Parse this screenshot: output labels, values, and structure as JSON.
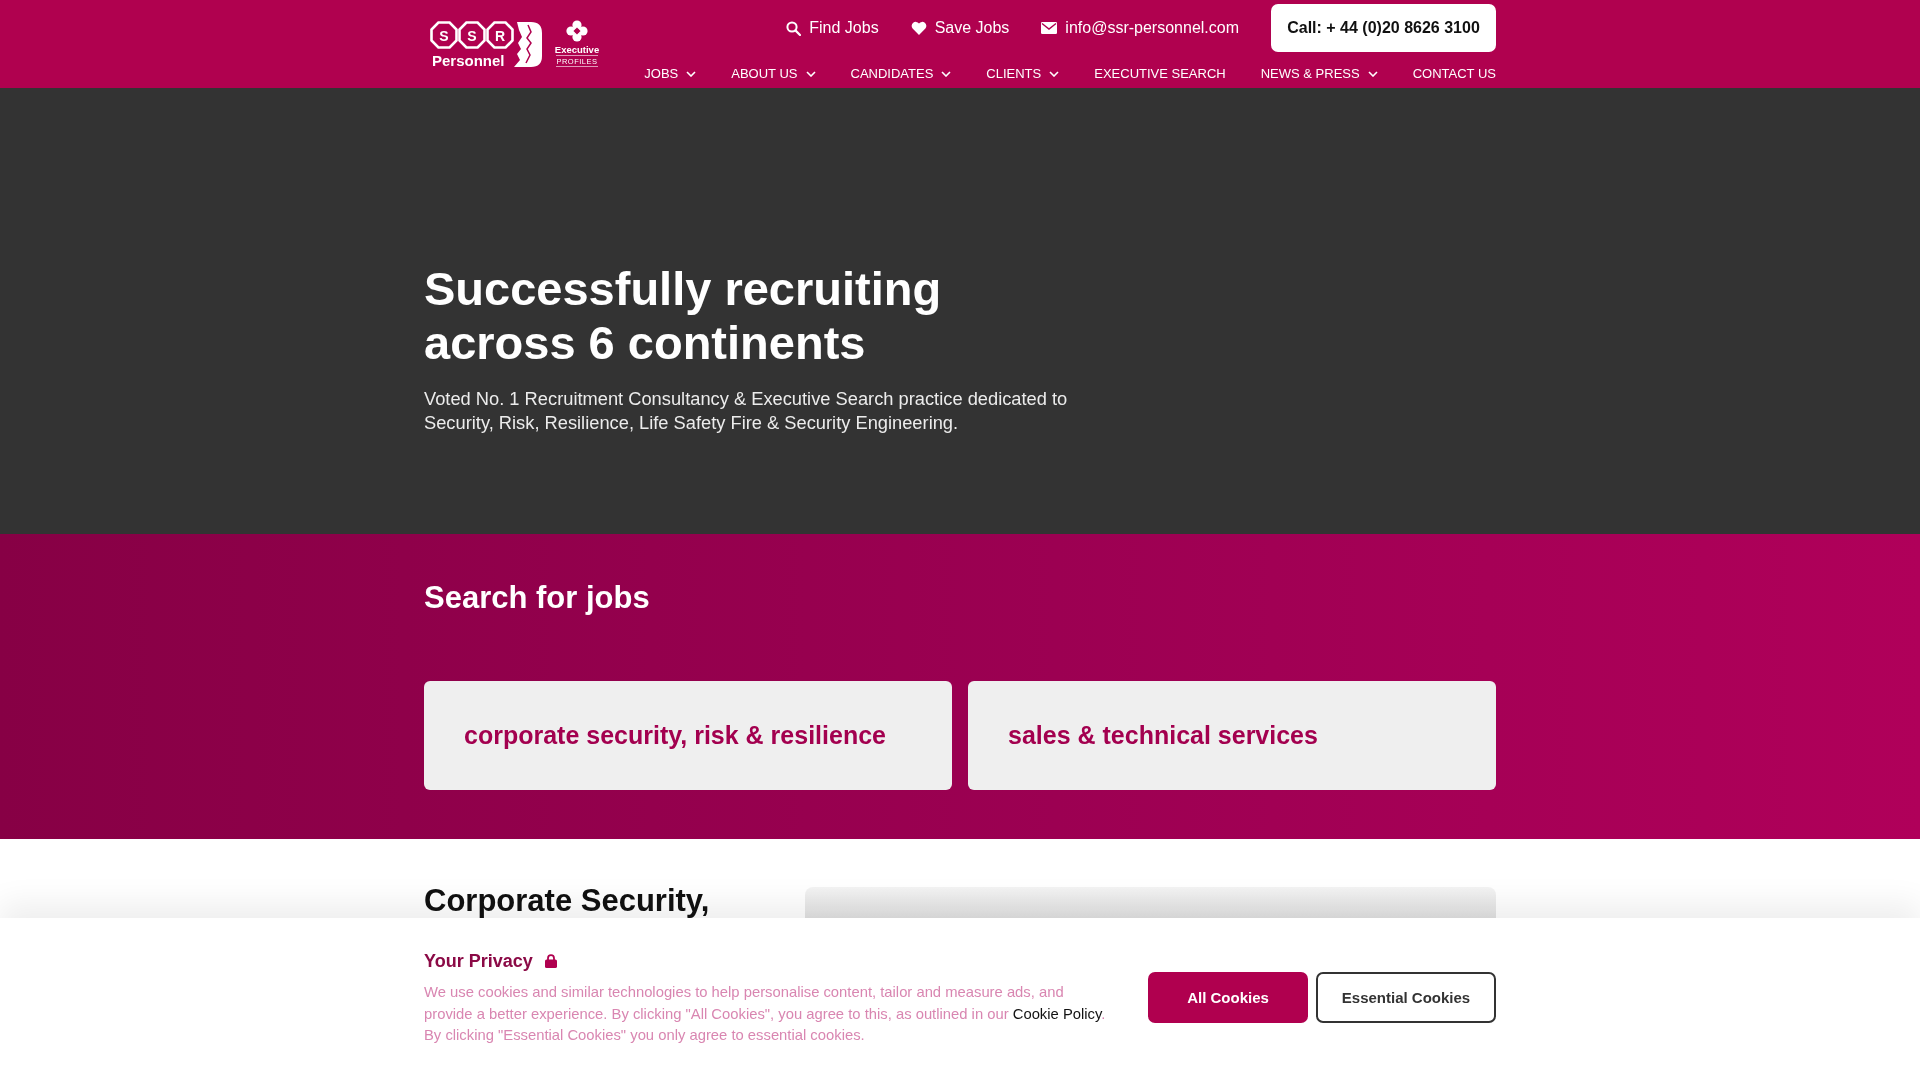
{
  "header": {
    "logo": {
      "letters": [
        "S",
        "S",
        "R"
      ],
      "name": "Personnel"
    },
    "partner_logo": {
      "name": "Executive",
      "tagline": "PROFILES"
    },
    "utility_links": [
      {
        "kind": "search",
        "label": "Find Jobs"
      },
      {
        "kind": "heart",
        "label": "Save Jobs"
      },
      {
        "kind": "email",
        "label": "info@ssr-personnel.com"
      }
    ],
    "call_button": "Call: + 44 (0)20 8626 3100",
    "nav": [
      {
        "label": "JOBS",
        "dropdown": true
      },
      {
        "label": "ABOUT US",
        "dropdown": true
      },
      {
        "label": "CANDIDATES",
        "dropdown": true
      },
      {
        "label": "CLIENTS",
        "dropdown": true
      },
      {
        "label": "EXECUTIVE SEARCH",
        "dropdown": false
      },
      {
        "label": "NEWS & PRESS",
        "dropdown": true
      },
      {
        "label": "CONTACT US",
        "dropdown": false
      }
    ]
  },
  "hero": {
    "title": "Successfully recruiting across 6 continents",
    "subtitle": "Voted No. 1 Recruitment Consultancy & Executive Search practice dedicated to Security, Risk, Resilience, Life Safety Fire & Security Engineering."
  },
  "job_search": {
    "title": "Search for jobs",
    "categories": [
      "corporate security, risk & resilience",
      "sales & technical services"
    ]
  },
  "section": {
    "title": "Corporate Security,"
  },
  "cookie_banner": {
    "title": "Your Privacy",
    "text": "We use cookies and similar technologies to help personalise content, tailor and measure ads, and provide a better experience. By clicking \"All Cookies\", you agree to this, as outlined in our ",
    "link": "Cookie Policy",
    "text_end": ". By clicking \"Essential Cookies\" you only agree to essential cookies.",
    "buttons": [
      {
        "kind": "primary",
        "label": "All Cookies"
      },
      {
        "kind": "secondary",
        "label": "Essential Cookies"
      }
    ]
  }
}
